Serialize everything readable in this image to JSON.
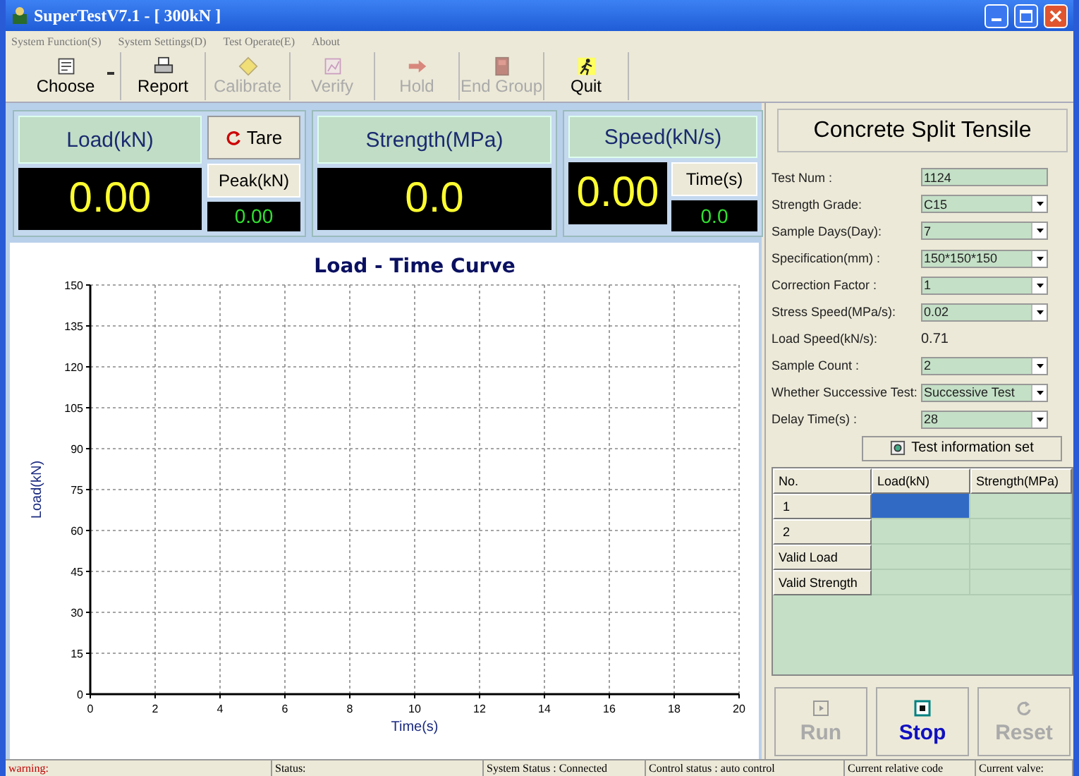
{
  "window": {
    "title": "SuperTestV7.1 - [ 300kN ]"
  },
  "menu": [
    {
      "label": "System Function(S)"
    },
    {
      "label": "System Settings(D)"
    },
    {
      "label": "Test Operate(E)"
    },
    {
      "label": "About"
    }
  ],
  "toolbar": [
    {
      "label": "Choose",
      "disabled": false,
      "dropdown": true
    },
    {
      "label": "Report",
      "disabled": false,
      "dropdown": false
    },
    {
      "label": "Calibrate",
      "disabled": true,
      "dropdown": false
    },
    {
      "label": "Verify",
      "disabled": true,
      "dropdown": false
    },
    {
      "label": "Hold",
      "disabled": true,
      "dropdown": false
    },
    {
      "label": "End Group",
      "disabled": true,
      "dropdown": false
    },
    {
      "label": "Quit",
      "disabled": false,
      "dropdown": false
    }
  ],
  "readouts": {
    "load": {
      "label": "Load(kN)",
      "value": "0.00"
    },
    "tare_button": "Tare",
    "peak": {
      "label": "Peak(kN)",
      "value": "0.00"
    },
    "strength": {
      "label": "Strength(MPa)",
      "value": "0.0"
    },
    "speed": {
      "label": "Speed(kN/s)",
      "value": "0.00"
    },
    "time": {
      "label": "Time(s)",
      "value": "0.0"
    }
  },
  "chart": {
    "chart_data": {
      "type": "line",
      "title": "Load - Time Curve",
      "xlabel": "Time(s)",
      "ylabel": "Load(kN)",
      "grid": true,
      "xlim": [
        0,
        20
      ],
      "ylim": [
        0,
        150
      ],
      "xticks": [
        0,
        2,
        4,
        6,
        8,
        10,
        12,
        14,
        16,
        18,
        20
      ],
      "yticks": [
        0,
        15,
        30,
        45,
        60,
        75,
        90,
        105,
        120,
        135,
        150
      ]
    }
  },
  "test_panel": {
    "title": "Concrete Split Tensile",
    "fields": [
      {
        "kind": "text",
        "label": "Test Num :",
        "value": "1124"
      },
      {
        "kind": "select",
        "label": "Strength Grade:",
        "value": "C15"
      },
      {
        "kind": "select",
        "label": "Sample Days(Day):",
        "value": "7"
      },
      {
        "kind": "select",
        "label": "Specification(mm) :",
        "value": "150*150*150"
      },
      {
        "kind": "select",
        "label": "Correction Factor :",
        "value": "1"
      },
      {
        "kind": "select",
        "label": "Stress Speed(MPa/s):",
        "value": "0.02"
      },
      {
        "kind": "readonly",
        "label": "Load Speed(kN/s):",
        "value": "0.71"
      },
      {
        "kind": "select",
        "label": "Sample Count :",
        "value": "2"
      },
      {
        "kind": "select",
        "label": "Whether Successive Test:",
        "value": "Successive Test"
      },
      {
        "kind": "select",
        "label": "Delay Time(s) :",
        "value": "28"
      }
    ],
    "info_button": "Test information set"
  },
  "results_table": {
    "columns": [
      "No.",
      "Load(kN)",
      "Strength(MPa)"
    ],
    "rows": [
      {
        "label": "1",
        "cells": [
          {
            "selected": true
          },
          {
            "selected": false
          }
        ]
      },
      {
        "label": "2",
        "cells": [
          {
            "selected": false
          },
          {
            "selected": false
          }
        ]
      },
      {
        "label": "Valid Load",
        "cells": [
          {
            "selected": false
          },
          {
            "selected": false
          }
        ]
      },
      {
        "label": "Valid Strength",
        "cells": [
          {
            "selected": false
          },
          {
            "selected": false
          }
        ]
      }
    ]
  },
  "controls": [
    {
      "label": "Run",
      "disabled": true
    },
    {
      "label": "Stop",
      "disabled": false
    },
    {
      "label": "Reset",
      "disabled": true
    }
  ],
  "status_bar": [
    {
      "text": "warning:",
      "kind": "warning"
    },
    {
      "text": "Status:",
      "kind": "plain"
    },
    {
      "text": "System Status : Connected",
      "kind": "plain"
    },
    {
      "text": "Control status : auto control",
      "kind": "plain"
    },
    {
      "text": "Current relative code",
      "kind": "plain"
    },
    {
      "text": "Current valve:",
      "kind": "plain"
    }
  ]
}
